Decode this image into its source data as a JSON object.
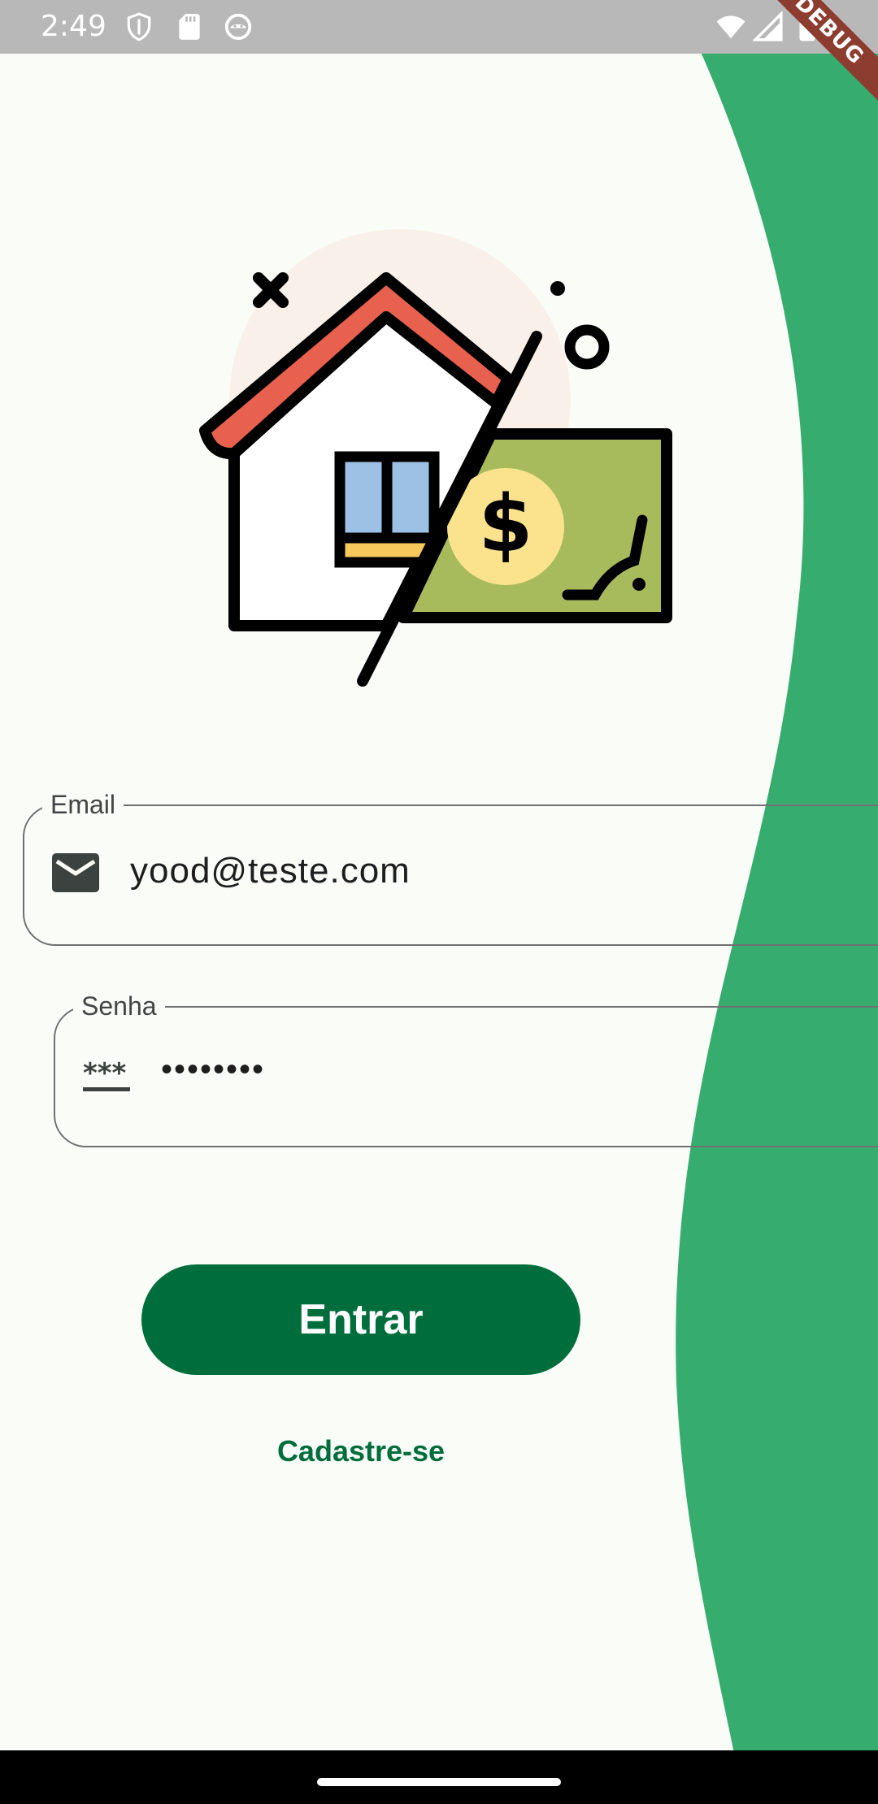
{
  "status_bar": {
    "time": "2:49",
    "icons": [
      "shield-icon",
      "sd-card-icon",
      "android-debug-icon",
      "wifi-icon",
      "signal-icon",
      "battery-icon"
    ]
  },
  "debug_banner": "DEBUG",
  "illustration": {
    "name": "house-money-icon",
    "currency_symbol": "$"
  },
  "login_form": {
    "email": {
      "label": "Email",
      "value": "yood@teste.com",
      "icon": "envelope-icon"
    },
    "senha": {
      "label": "Senha",
      "value": "••••••••",
      "icon": "password-icon"
    },
    "submit_label": "Entrar",
    "signup_label": "Cadastre-se"
  },
  "colors": {
    "background": "#fafcf8",
    "wave": "#36ac6e",
    "primary": "#006e3c",
    "roof": "#e8604e",
    "bill": "#a8bb5c",
    "coin": "#fbe38e",
    "window": "#9dc1e5"
  }
}
